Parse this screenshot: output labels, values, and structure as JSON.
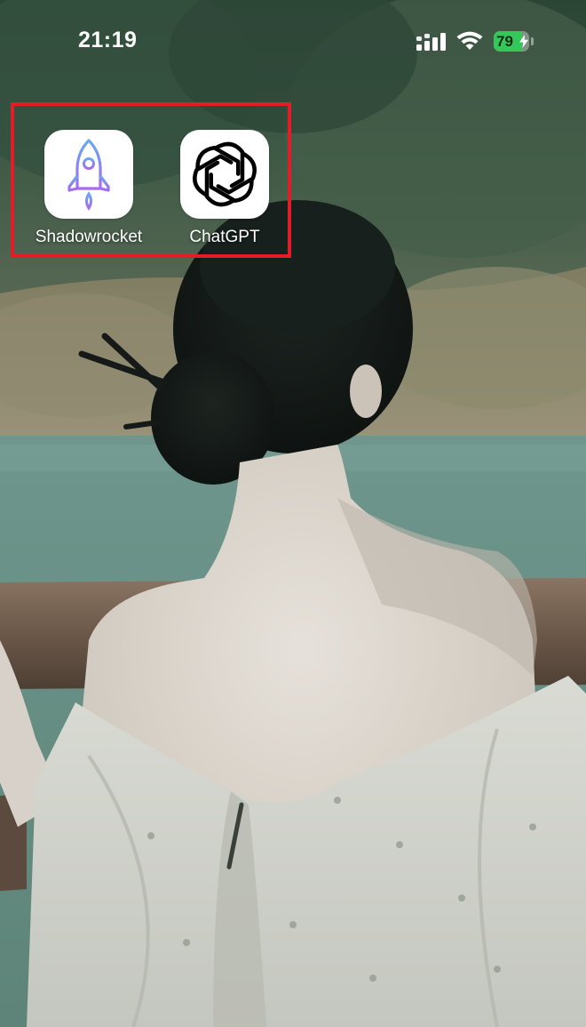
{
  "status_bar": {
    "time": "21:19",
    "battery_percent": "79",
    "battery_level": 0.79,
    "signal_icon": "cellular-signal-icon",
    "wifi_icon": "wifi-icon",
    "colors": {
      "battery_fill": "#34c759",
      "text": "#ffffff"
    }
  },
  "home_screen": {
    "apps": [
      {
        "label": "Shadowrocket",
        "icon": "rocket-icon"
      },
      {
        "label": "ChatGPT",
        "icon": "openai-knot-icon"
      }
    ],
    "highlight_color": "#e11d27"
  },
  "wallpaper": {
    "description_icon": "wallpaper-photo"
  }
}
